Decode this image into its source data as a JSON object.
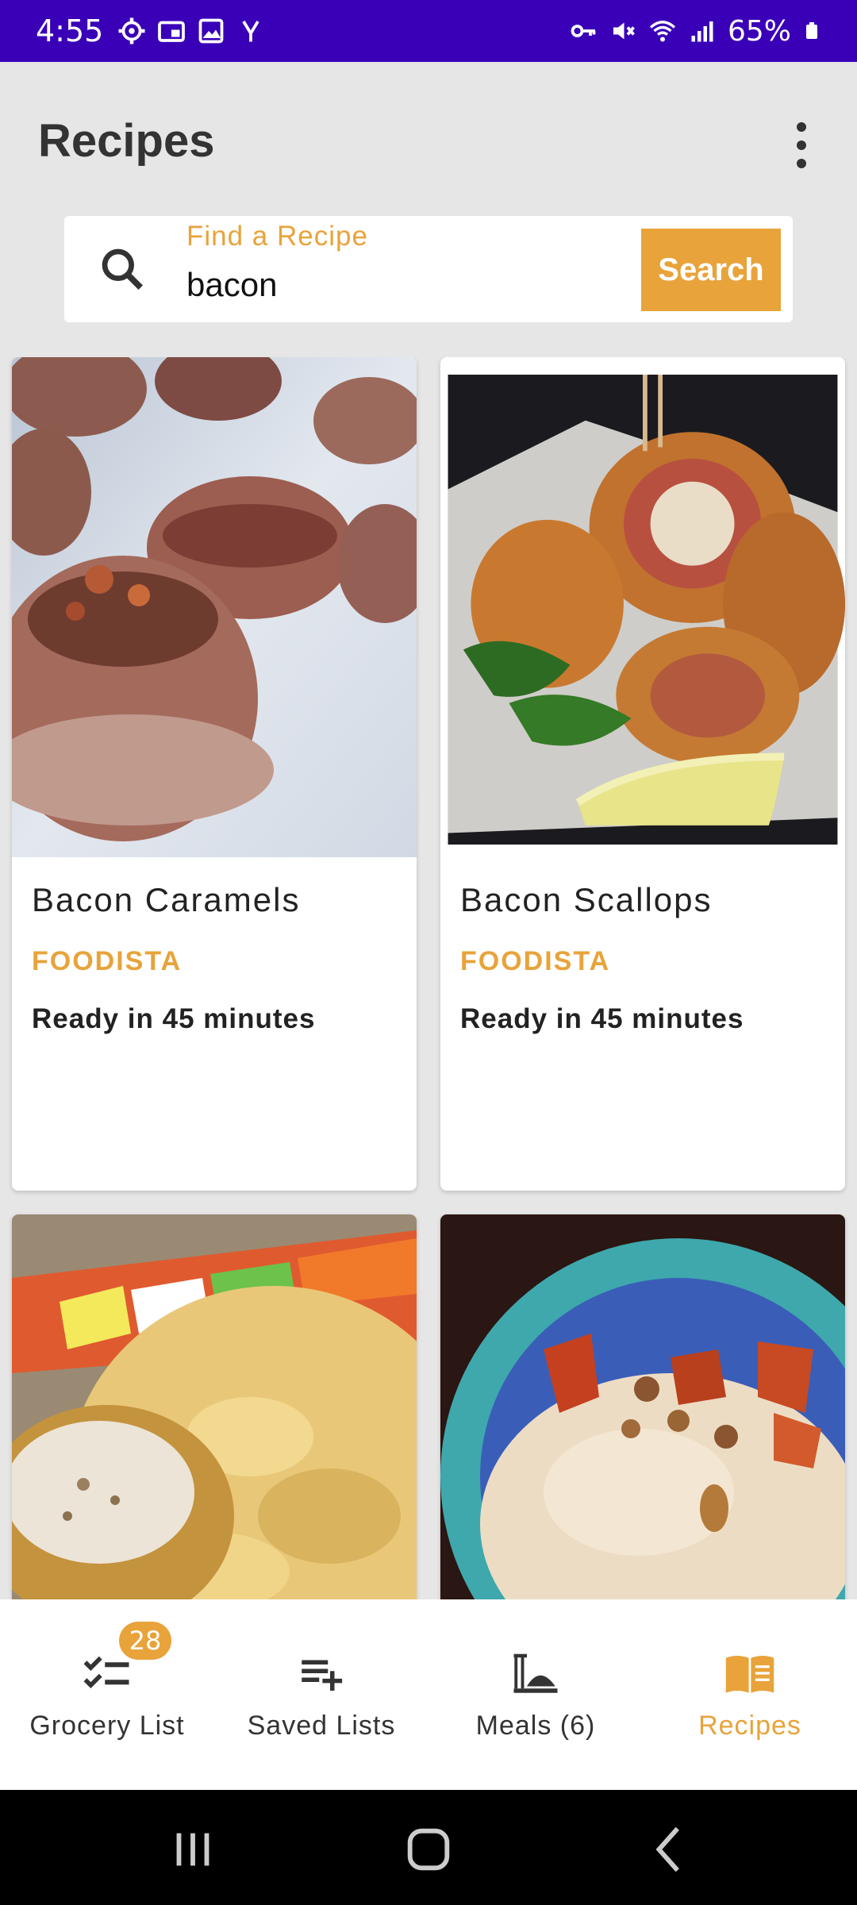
{
  "status_bar": {
    "time": "4:55",
    "battery": "65%",
    "left_icons": [
      "settings-gear-icon",
      "sim-card-icon",
      "image-icon",
      "network-y-icon"
    ],
    "right_icons": [
      "vpn-key-icon",
      "mute-icon",
      "wifi-icon",
      "cellular-signal-icon",
      "battery-icon"
    ],
    "background": "#3a00b8"
  },
  "app_bar": {
    "title": "Recipes",
    "menu_icon": "more-vert-icon"
  },
  "search": {
    "label": "Find a Recipe",
    "value": "bacon",
    "button_label": "Search",
    "icon": "search-icon"
  },
  "recipes": [
    {
      "title": "Bacon Caramels",
      "source": "FOODISTA",
      "ready": "Ready in 45 minutes"
    },
    {
      "title": "Bacon Scallops",
      "source": "FOODISTA",
      "ready": "Ready in 45 minutes"
    },
    {
      "title": "",
      "source": "",
      "ready": ""
    },
    {
      "title": "",
      "source": "",
      "ready": ""
    }
  ],
  "bottom_nav": {
    "items": [
      {
        "label": "Grocery List",
        "icon": "checklist-icon",
        "badge": "28",
        "active": false
      },
      {
        "label": "Saved Lists",
        "icon": "playlist-add-icon",
        "active": false
      },
      {
        "label": "Meals (6)",
        "icon": "meal-platter-icon",
        "active": false
      },
      {
        "label": "Recipes",
        "icon": "book-icon",
        "active": true
      }
    ]
  },
  "system_nav": {
    "buttons": [
      "recent-apps-icon",
      "home-icon",
      "back-icon"
    ]
  },
  "colors": {
    "accent": "#e8a33a",
    "background": "#e6e6e6",
    "status_bar": "#3a00b8"
  }
}
